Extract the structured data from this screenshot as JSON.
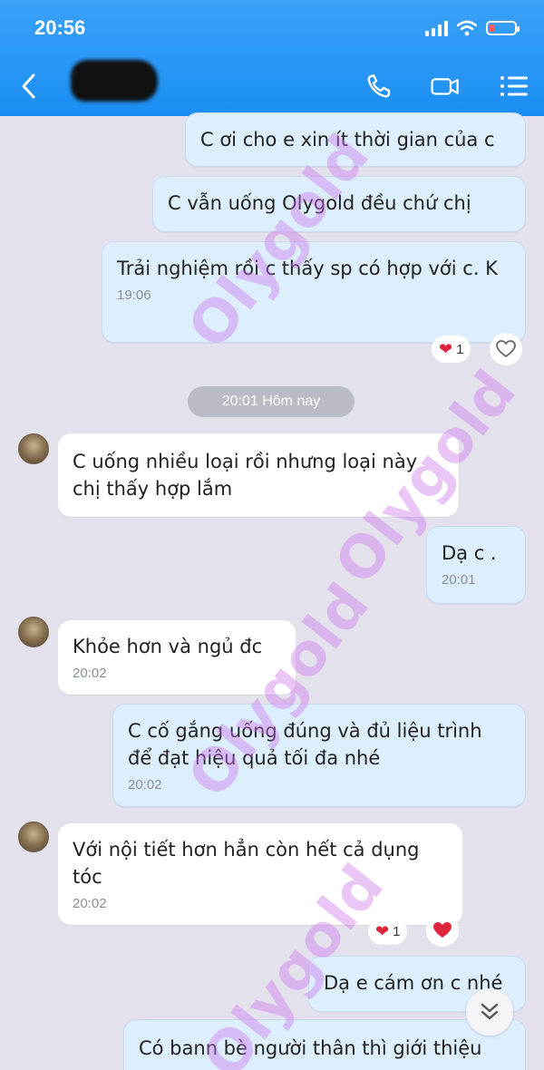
{
  "status_bar": {
    "time": "20:56"
  },
  "header": {
    "contact_name_redacted": true
  },
  "messages": [
    {
      "direction": "out",
      "text": "C ơi cho e xin ít thời gian của c"
    },
    {
      "direction": "out",
      "text": "C vẫn uống Olygold đều chứ chị"
    },
    {
      "direction": "out",
      "text": "Trải nghiệm rồi c thấy sp có hợp với c. K",
      "time": "19:06",
      "reaction": {
        "emoji": "❤",
        "count": "1"
      }
    },
    {
      "direction": "in",
      "text": "C uống nhiều loại rồi nhưng loại này chị thấy hợp lắm"
    },
    {
      "direction": "out",
      "text": "Dạ c .",
      "time": "20:01"
    },
    {
      "direction": "in",
      "text": "Khỏe hơn và ngủ đc",
      "time": "20:02"
    },
    {
      "direction": "out",
      "text": "C cố gắng uống đúng và đủ liệu trình để đạt hiệu quả tối đa nhé",
      "time": "20:02"
    },
    {
      "direction": "in",
      "text": "Với nội tiết hơn hẳn còn hết cả dụng tóc",
      "time": "20:02",
      "reaction": {
        "emoji": "❤",
        "count": "1"
      }
    },
    {
      "direction": "out",
      "text": "Dạ e cám ơn c nhé"
    },
    {
      "direction": "out",
      "text": "Có bann bè người thân thì giới thiệu"
    }
  ],
  "date_separator": "20:01 Hôm nay",
  "watermark": "Olygold",
  "colors": {
    "header": "#1b8ef3",
    "outgoing_bubble": "#ddeefd",
    "incoming_bubble": "#ffffff",
    "background": "#e3e1ec",
    "watermark": "#cd78eb"
  }
}
